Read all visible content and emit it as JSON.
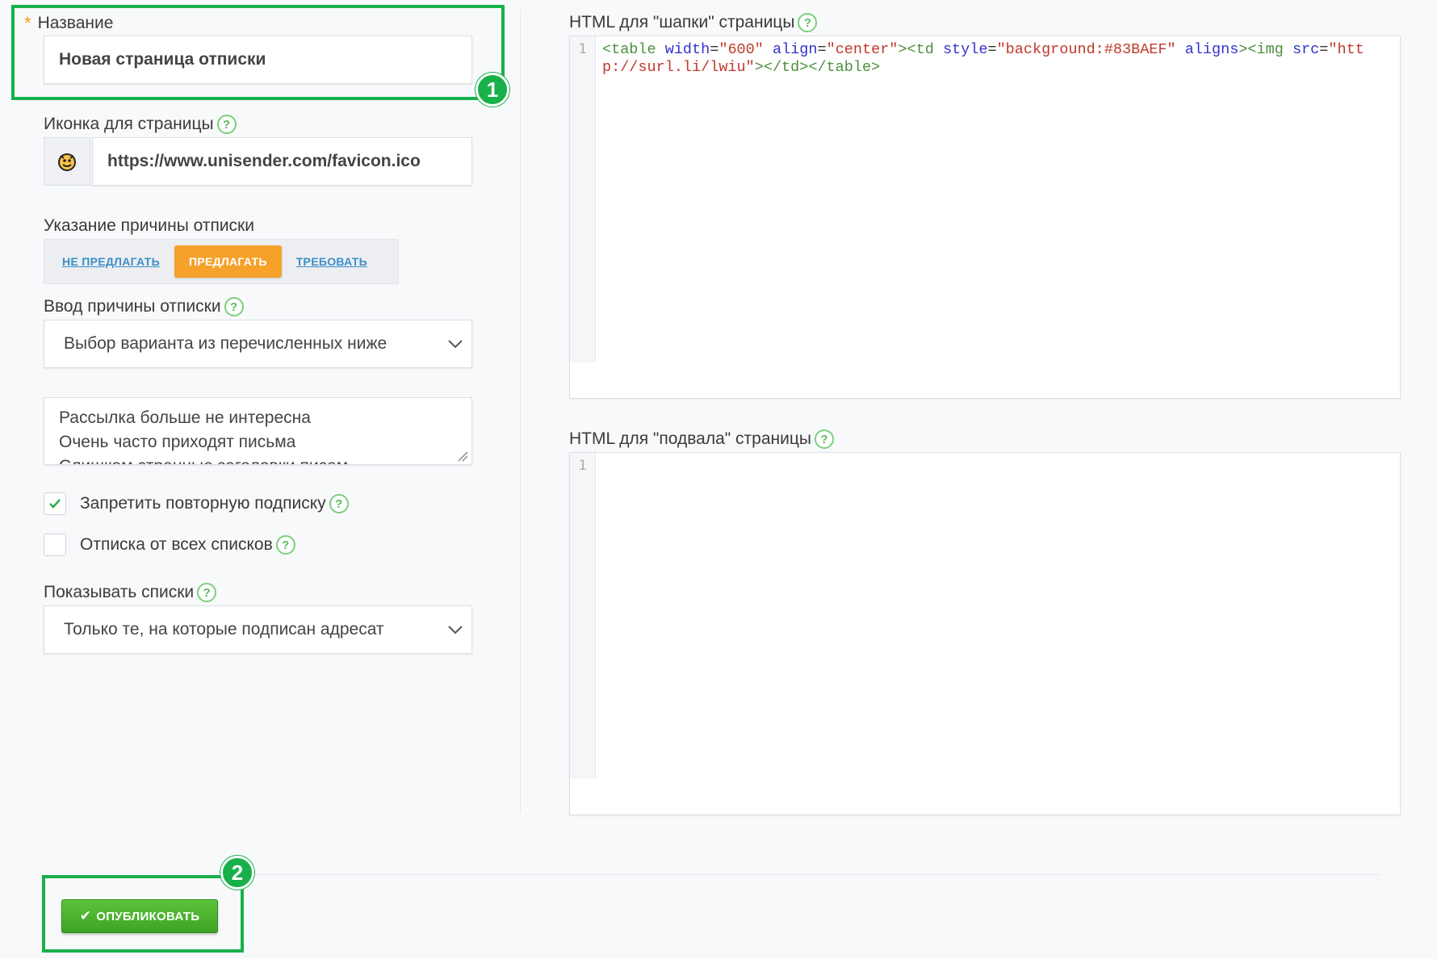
{
  "form": {
    "name": {
      "label": "Название",
      "required_mark": "*",
      "value": "Новая страница отписки"
    },
    "icon": {
      "label": "Иконка для страницы",
      "help": "?",
      "value": "https://www.unisender.com/favicon.ico"
    },
    "reason_mode": {
      "label": "Указание причины отписки",
      "options": [
        "НЕ ПРЕДЛАГАТЬ",
        "ПРЕДЛАГАТЬ",
        "ТРЕБОВАТЬ"
      ],
      "selected": "ПРЕДЛАГАТЬ"
    },
    "reason_input": {
      "label": "Ввод причины отписки",
      "help": "?",
      "value": "Выбор варианта из перечисленных ниже"
    },
    "reasons_text": {
      "lines": [
        "Рассылка больше не интересна",
        "Очень часто приходят письма",
        "Слишком странные заголовки писем"
      ]
    },
    "forbid_resubscribe": {
      "label": "Запретить повторную подписку",
      "help": "?",
      "checked": true
    },
    "unsubscribe_all": {
      "label": "Отписка от всех списков",
      "help": "?",
      "checked": false
    },
    "show_lists": {
      "label": "Показывать списки",
      "help": "?",
      "value": "Только те, на которые подписан адресат"
    }
  },
  "header_html": {
    "label": "HTML для \"шапки\" страницы",
    "help": "?",
    "line_number": "1",
    "code_tokens": [
      {
        "t": "tag",
        "v": "<table "
      },
      {
        "t": "attr",
        "v": "width"
      },
      {
        "t": "plain",
        "v": "="
      },
      {
        "t": "str",
        "v": "\"600\" "
      },
      {
        "t": "attr",
        "v": "align"
      },
      {
        "t": "plain",
        "v": "="
      },
      {
        "t": "str",
        "v": "\"center\""
      },
      {
        "t": "tag",
        "v": "><td "
      },
      {
        "t": "attr",
        "v": "style"
      },
      {
        "t": "plain",
        "v": "="
      },
      {
        "t": "str",
        "v": "\"background:#83BAEF\" "
      },
      {
        "t": "attr",
        "v": "aligns"
      },
      {
        "t": "tag",
        "v": "><img "
      },
      {
        "t": "attr",
        "v": "src"
      },
      {
        "t": "plain",
        "v": "="
      },
      {
        "t": "str",
        "v": "\"http://surl.li/lwiu\""
      },
      {
        "t": "tag",
        "v": "></td></table>"
      }
    ]
  },
  "footer_html": {
    "label": "HTML для \"подвала\" страницы",
    "help": "?",
    "line_number": "1"
  },
  "callouts": {
    "one": "1",
    "two": "2"
  },
  "publish": {
    "label": "ОПУБЛИКОВАТЬ",
    "check_glyph": "✔"
  },
  "colors": {
    "accent_orange": "#f5a12a",
    "callout_green": "#17b04a",
    "link_blue": "#3b8fc8",
    "publish_green": "#4bb52e"
  }
}
